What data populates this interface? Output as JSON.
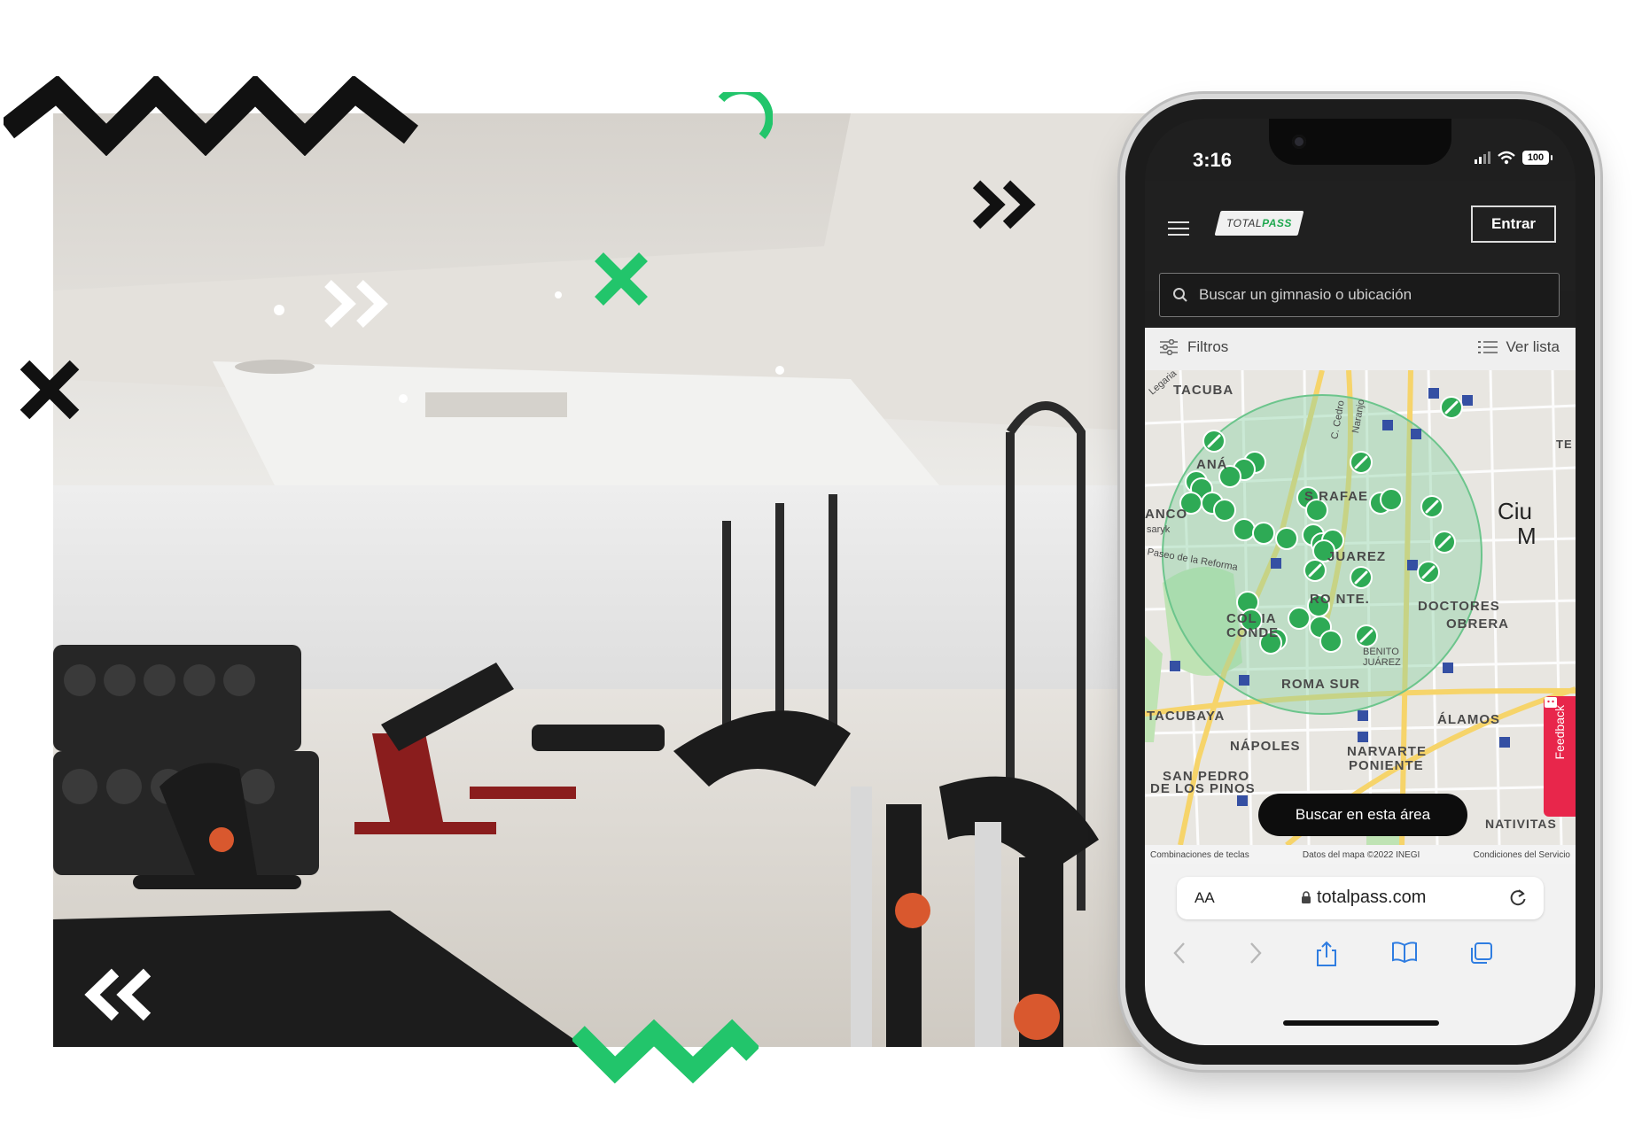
{
  "phone": {
    "status_time": "3:16",
    "battery": "100",
    "header": {
      "logo_total": "TOTAL",
      "logo_pass": "PASS",
      "enter_label": "Entrar"
    },
    "search": {
      "placeholder": "Buscar un gimnasio o ubicación"
    },
    "filters_label": "Filtros",
    "list_label": "Ver lista",
    "map": {
      "labels": {
        "tacuba": "TACUBA",
        "anahuac": "ANÁ",
        "anco": "ANCO",
        "sarafael": "S   RAFAE",
        "juarez": "JUAREZ",
        "roma_norte": "RO   NTE.",
        "doctores": "DOCTORES",
        "obrera": "OBRERA",
        "colonia": "COL   IA",
        "conde": "CONDE",
        "benito": "BENITO",
        "benito2": "JUÁREZ",
        "roma_sur": "ROMA SUR",
        "tacubaya": "TACUBAYA",
        "alamos": "ÁLAMOS",
        "napoles": "NÁPOLES",
        "narvarte": "NARVARTE",
        "poniente": "PONIENTE",
        "san_pedro": "SAN PEDRO",
        "los_pinos": "DE LOS PINOS",
        "ciudad": "Ciu",
        "ciudad2": "M",
        "reforma": "Paseo de la Reforma",
        "legaria": "Legaria",
        "cedro": "C. Cedro",
        "naranjo": "Naranjo",
        "saryk": "saryk",
        "natividad": "NATIVITAS",
        "te": "TE",
        "s_label": "S"
      },
      "feedback_label": "Feedback",
      "search_area_label": "Buscar en esta área",
      "footer": {
        "shortcuts": "Combinaciones de teclas",
        "data": "Datos del mapa ©2022 INEGI",
        "terms": "Condiciones del Servicio"
      }
    },
    "browser": {
      "text_size": "AA",
      "url": "totalpass.com"
    }
  },
  "colors": {
    "accent_green": "#22c56b",
    "marker_green": "#2eaa55",
    "feedback_red": "#e8264b",
    "dark": "#1f1f1f"
  },
  "icons": [
    "zigzag-icon",
    "arc-icon",
    "double-chevron-right-icon",
    "x-mark-icon",
    "double-chevron-left-icon",
    "menu-icon",
    "search-icon",
    "filter-icon",
    "list-icon",
    "lock-icon",
    "reload-icon",
    "back-icon",
    "forward-icon",
    "share-icon",
    "bookmarks-icon",
    "tabs-icon",
    "dumbbell-marker-icon"
  ]
}
